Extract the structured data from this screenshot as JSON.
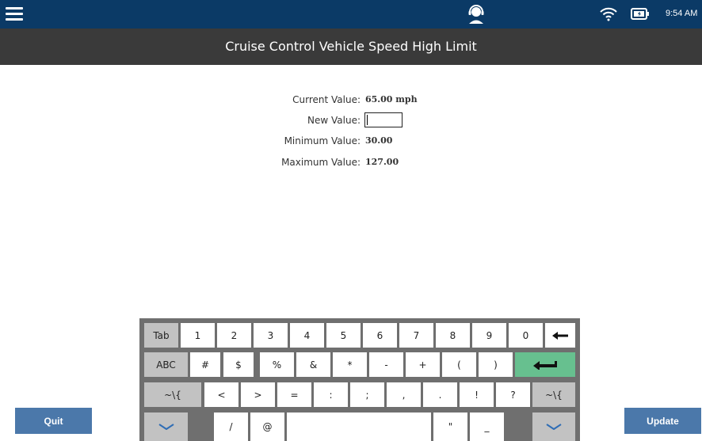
{
  "status_bar": {
    "time": "9:54 AM"
  },
  "title": "Cruise Control Vehicle Speed High Limit",
  "fields": {
    "current_label": "Current Value:",
    "current_value": "65.00 mph",
    "new_label": "New Value:",
    "new_value": "",
    "minimum_label": "Minimum Value:",
    "minimum_value": "30.00",
    "maximum_label": "Maximum Value:",
    "maximum_value": "127.00"
  },
  "keyboard": {
    "row1": [
      "Tab",
      "1",
      "2",
      "3",
      "4",
      "5",
      "6",
      "7",
      "8",
      "9",
      "0"
    ],
    "row2": [
      "ABC",
      "#",
      "$",
      "%",
      "&",
      "*",
      "-",
      "+",
      "(",
      ")"
    ],
    "row3": [
      "~\\{",
      "<",
      ">",
      "=",
      ":",
      ";",
      ",",
      ".",
      "!",
      "?",
      "~\\{"
    ],
    "row4": [
      "/",
      "@",
      "\"",
      "_"
    ]
  },
  "buttons": {
    "quit": "Quit",
    "update": "Update"
  },
  "colors": {
    "topbar": "#0b3a66",
    "titlebar": "#3a3a3a",
    "button": "#4b78aa",
    "enter_key": "#67c08f"
  }
}
